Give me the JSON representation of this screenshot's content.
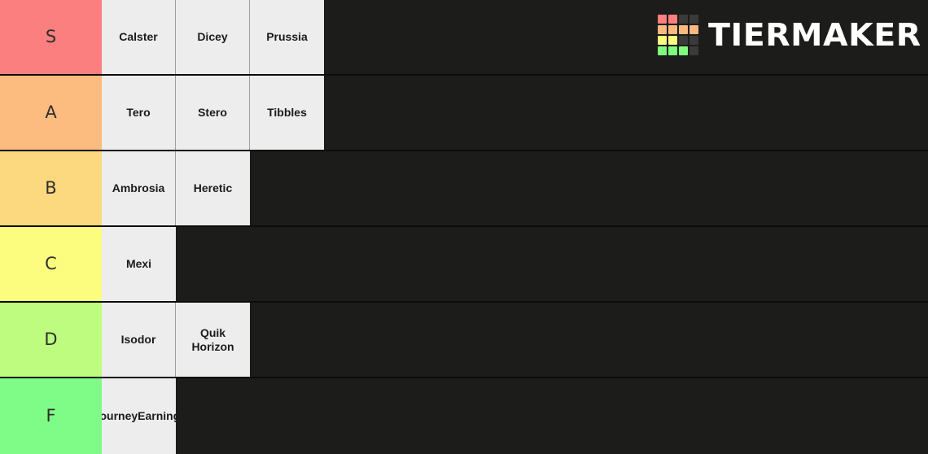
{
  "brand": {
    "name": "TIERMAKER",
    "logo_icon": "tiermaker-grid-icon",
    "logo_grid_colors": [
      [
        "#fc7f7f",
        "#fc7f7f",
        "#3a3a38",
        "#3a3a38"
      ],
      [
        "#fcb97f",
        "#fcb97f",
        "#fcb97f",
        "#fcb97f"
      ],
      [
        "#fcfc7f",
        "#fcfc7f",
        "#3a3a38",
        "#3a3a38"
      ],
      [
        "#7ffc7f",
        "#7ffc7f",
        "#7ffc7f",
        "#3a3a38"
      ]
    ]
  },
  "theme": {
    "background": "#1c1c1a",
    "dropzone": "#1c1c1a",
    "row_divider": "#0c0c0b",
    "item_background": "#ededed",
    "item_divider": "#9d9d9d",
    "item_text": "#1b1b1b",
    "tier_label_text": "#2e2e2e"
  },
  "tiers": [
    {
      "label": "S",
      "color": "#fc7f7f",
      "items": [
        {
          "name": "Calster",
          "clipped": false,
          "wrap": false
        },
        {
          "name": "Dicey",
          "clipped": false,
          "wrap": false
        },
        {
          "name": "Prussia",
          "clipped": false,
          "wrap": false
        }
      ]
    },
    {
      "label": "A",
      "color": "#fcbc7f",
      "items": [
        {
          "name": "Tero",
          "clipped": false,
          "wrap": false
        },
        {
          "name": "Stero",
          "clipped": false,
          "wrap": false
        },
        {
          "name": "Tibbles",
          "clipped": false,
          "wrap": false
        }
      ]
    },
    {
      "label": "B",
      "color": "#fcd97f",
      "items": [
        {
          "name": "Ambrosia",
          "clipped": false,
          "wrap": false
        },
        {
          "name": "Heretic",
          "clipped": false,
          "wrap": false
        }
      ]
    },
    {
      "label": "C",
      "color": "#fcfc7f",
      "items": [
        {
          "name": "Mexi",
          "clipped": false,
          "wrap": false
        }
      ]
    },
    {
      "label": "D",
      "color": "#bdfc7f",
      "items": [
        {
          "name": "Isodor",
          "clipped": false,
          "wrap": false
        },
        {
          "name": "Quik Horizon",
          "clipped": false,
          "wrap": true
        }
      ]
    },
    {
      "label": "F",
      "color": "#7ffc87",
      "items": [
        {
          "name": "TourneyEarnings",
          "clipped": true,
          "wrap": false
        }
      ]
    }
  ]
}
